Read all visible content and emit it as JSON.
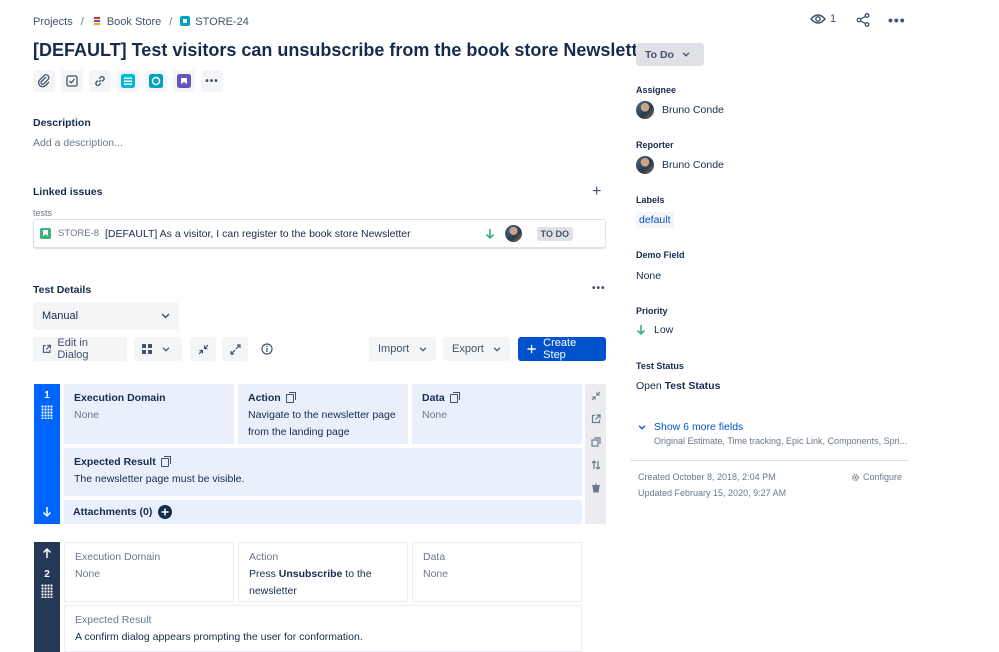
{
  "breadcrumb": {
    "projects": "Projects",
    "project": "Book Store",
    "issue_key": "STORE-24"
  },
  "header": {
    "watch_count": "1"
  },
  "issue": {
    "title": "[DEFAULT] Test visitors can unsubscribe from the book store Newsletter"
  },
  "description": {
    "heading": "Description",
    "placeholder": "Add a description..."
  },
  "linked_issues": {
    "heading": "Linked issues",
    "relation": "tests",
    "items": [
      {
        "key": "STORE-8",
        "summary": "[DEFAULT] As a visitor, I can register to the book store Newsletter",
        "status": "TO DO"
      }
    ]
  },
  "test_details": {
    "heading": "Test Details",
    "test_type": "Manual",
    "edit_in_dialog": "Edit in Dialog",
    "import": "Import",
    "export": "Export",
    "create_step": "Create Step"
  },
  "steps": [
    {
      "number": "1",
      "execution_domain_label": "Execution Domain",
      "execution_domain_value": "None",
      "action_label": "Action",
      "action_value": "Navigate to the newsletter page from the landing page",
      "data_label": "Data",
      "data_value": "None",
      "expected_label": "Expected Result",
      "expected_value": "The newsletter page must be visible.",
      "attachments_label": "Attachments (0)"
    },
    {
      "number": "2",
      "execution_domain_label": "Execution Domain",
      "execution_domain_value": "None",
      "action_label": "Action",
      "action_prefix": "Press ",
      "action_bold": "Unsubscribe",
      "action_suffix": " to the newsletter",
      "data_label": "Data",
      "data_value": "None",
      "expected_label": "Expected Result",
      "expected_value": "A confirm dialog appears prompting the user for conformation."
    }
  ],
  "sidebar": {
    "status": "To Do",
    "assignee_label": "Assignee",
    "assignee": "Bruno Conde",
    "reporter_label": "Reporter",
    "reporter": "Bruno Conde",
    "labels_label": "Labels",
    "label_value": "default",
    "demo_field_label": "Demo Field",
    "demo_field_value": "None",
    "priority_label": "Priority",
    "priority_value": "Low",
    "test_status_label": "Test Status",
    "test_status_prefix": "Open",
    "test_status_bold": "Test Status",
    "show_more": "Show 6 more fields",
    "show_more_sub": "Original Estimate, Time tracking, Epic Link, Components, Spri...",
    "created": "Created October 8, 2018, 2:04 PM",
    "updated": "Updated February 15, 2020, 9:27 AM",
    "configure": "Configure"
  },
  "colors": {
    "primary": "#0052cc",
    "step_active": "#0065ff",
    "step_inactive": "#253858",
    "cell_bg": "#e9f0fc",
    "story_green": "#36b37e"
  }
}
